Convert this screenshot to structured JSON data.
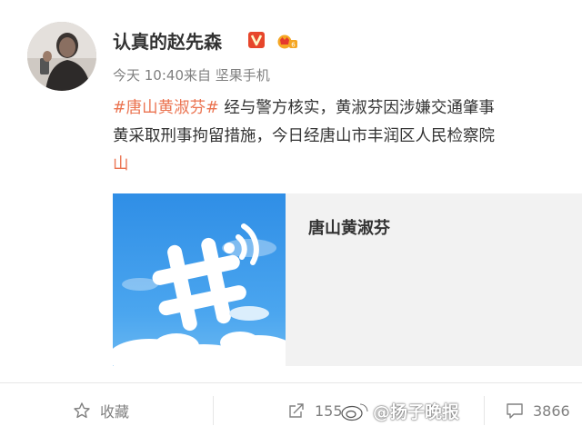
{
  "post": {
    "username": "认真的赵先森",
    "timestamp": "今天 10:40",
    "source_prefix": "来自",
    "source": "坚果手机",
    "hashtag": "#唐山黄淑芬#",
    "line1_rest": " 经与警方核实，黄淑芬因涉嫌交通肇事",
    "line2": "黄采取刑事拘留措施，今日经唐山市丰润区人民检察院",
    "line3_link": "山"
  },
  "card": {
    "title": "唐山黄淑芬"
  },
  "actions": {
    "favorite_label": "收藏",
    "repost_count": "155",
    "comment_count": "3866"
  },
  "watermark": {
    "text": "@扬子晚报"
  },
  "icons": {
    "verified": "verified-v-icon",
    "level": "level-crown-icon",
    "favorite": "star-icon",
    "repost": "share-icon",
    "comment": "comment-icon"
  },
  "colors": {
    "accent": "#eb7350",
    "verified": "#e7462b",
    "meta_gray": "#808080",
    "card_bg": "#f2f2f2",
    "thumb_blue": "#3b9beb"
  }
}
